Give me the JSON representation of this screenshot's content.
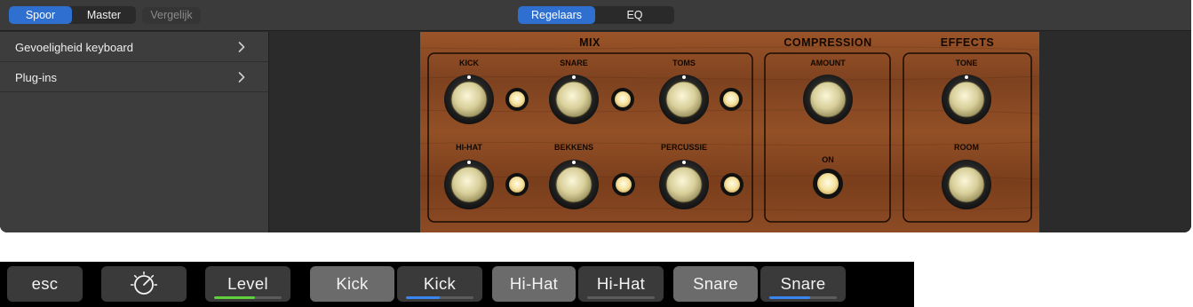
{
  "header": {
    "segment_left": [
      {
        "label": "Spoor",
        "selected": true
      },
      {
        "label": "Master",
        "selected": false
      }
    ],
    "compare_label": "Vergelijk",
    "segment_center": [
      {
        "label": "Regelaars",
        "selected": true
      },
      {
        "label": "EQ",
        "selected": false
      }
    ]
  },
  "sidebar": {
    "items": [
      {
        "label": "Gevoeligheid keyboard",
        "icon": "chevron-right-icon"
      },
      {
        "label": "Plug-ins",
        "icon": "chevron-right-icon"
      }
    ]
  },
  "plugin": {
    "mix": {
      "title": "MIX",
      "channels": [
        "KICK",
        "SNARE",
        "TOMS",
        "HI-HAT",
        "BEKKENS",
        "PERCUSSIE"
      ]
    },
    "compression": {
      "title": "COMPRESSION",
      "amount_label": "AMOUNT",
      "on_label": "ON"
    },
    "effects": {
      "title": "EFFECTS",
      "tone_label": "TONE",
      "room_label": "ROOM"
    }
  },
  "touchbar": {
    "esc_label": "esc",
    "controls_icon": "knob-icon",
    "level_label": "Level",
    "level_value": 0.6,
    "pairs": [
      {
        "a": "Kick",
        "b": "Kick",
        "value": 0.5
      },
      {
        "a": "Hi-Hat",
        "b": "Hi-Hat",
        "value": 0.0
      },
      {
        "a": "Snare",
        "b": "Snare",
        "value": 0.6
      }
    ]
  },
  "colors": {
    "accent": "#2e6fd0",
    "level_bar": "#5fcf3c",
    "slider_bar": "#3a86f0",
    "wood": "#8a4a22",
    "lamp": "#f6e3a0"
  }
}
